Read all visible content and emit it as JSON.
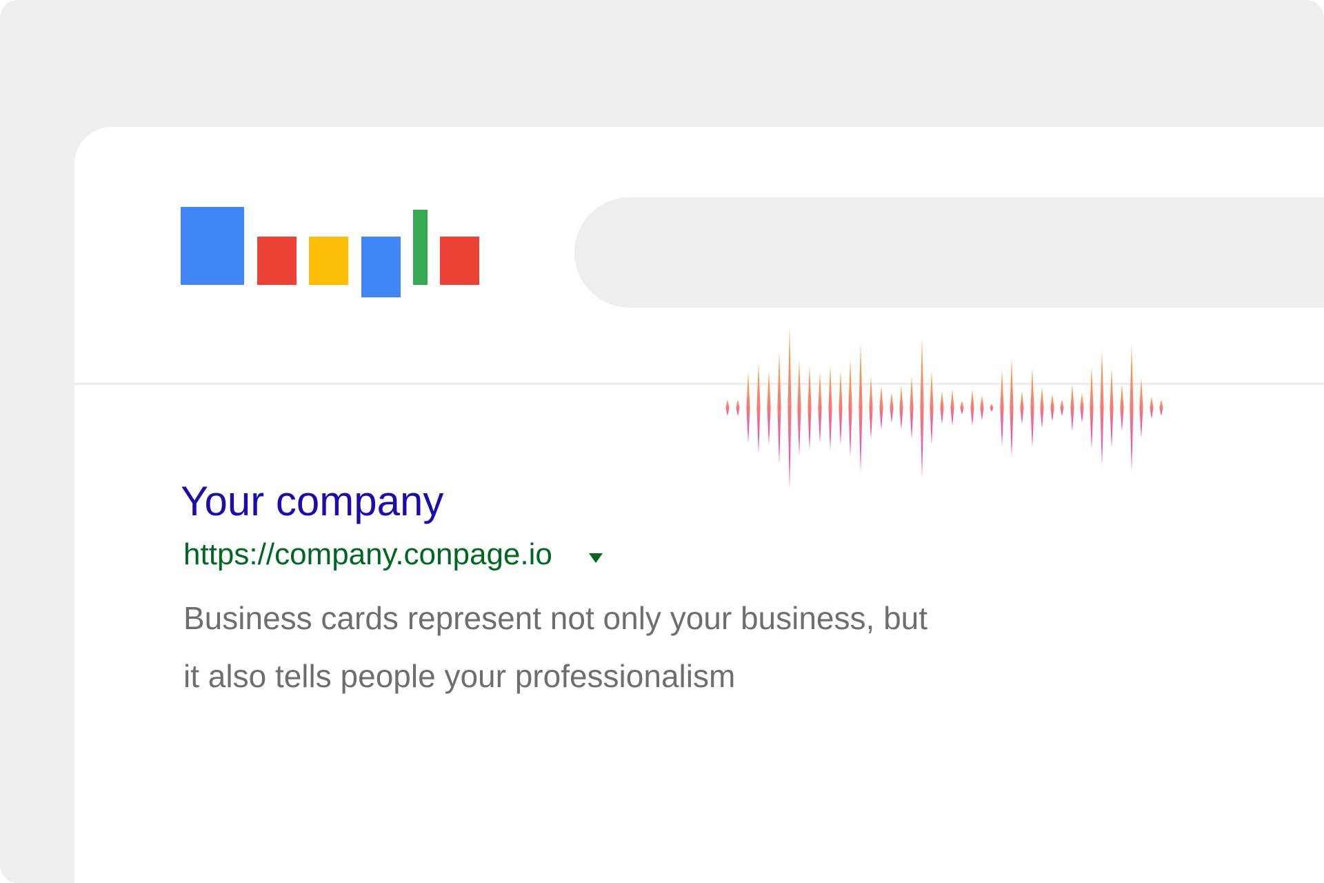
{
  "colors": {
    "frame_background": "#eeeeee",
    "window_background": "#ffffff",
    "search_bar": "#eeeeee",
    "divider": "#ececec",
    "title_link": "#1a0dab",
    "url_green": "#006621",
    "snippet_gray": "#6e6e6e",
    "logo_blue": "#4285f4",
    "logo_red": "#ea4335",
    "logo_yellow": "#fbbc05",
    "logo_green": "#34a853",
    "wave_top": "#f7a648",
    "wave_mid": "#f3777b",
    "wave_bottom": "#e93ad6"
  },
  "logo": {
    "icon": "search-engine-logo-blocks"
  },
  "search": {
    "query": ""
  },
  "voice_wave": {
    "icon": "voice-waveform-icon"
  },
  "result": {
    "title": "Your company",
    "url": "https://company.conpage.io",
    "url_menu_icon": "dropdown-triangle-icon",
    "snippet_line_1": "Business cards represent not only your business, but",
    "snippet_line_2": "it also tells people your professionalism"
  }
}
